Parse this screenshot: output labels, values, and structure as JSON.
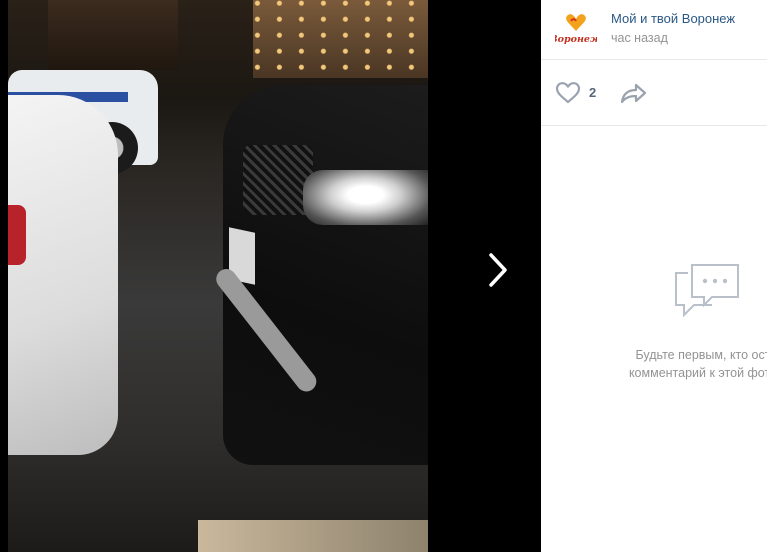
{
  "photo": {
    "alt": ""
  },
  "navigation": {
    "next_icon": "chevron-right-icon"
  },
  "author": {
    "name": "Мой и твой Воронеж",
    "time": "час назад",
    "avatar_text": "Воронеж",
    "avatar_icon": "heart-logo"
  },
  "actions": {
    "like_icon": "heart-outline-icon",
    "like_count": "2",
    "share_icon": "share-arrow-icon"
  },
  "comments": {
    "empty_icon": "comments-bubble-icon",
    "empty_line1": "Будьте первым, кто ост",
    "empty_line2": "комментарий к этой фото"
  },
  "colors": {
    "link": "#2a5885",
    "muted": "#939393",
    "icon": "#99a2ad",
    "divider": "#e7e8ec"
  }
}
